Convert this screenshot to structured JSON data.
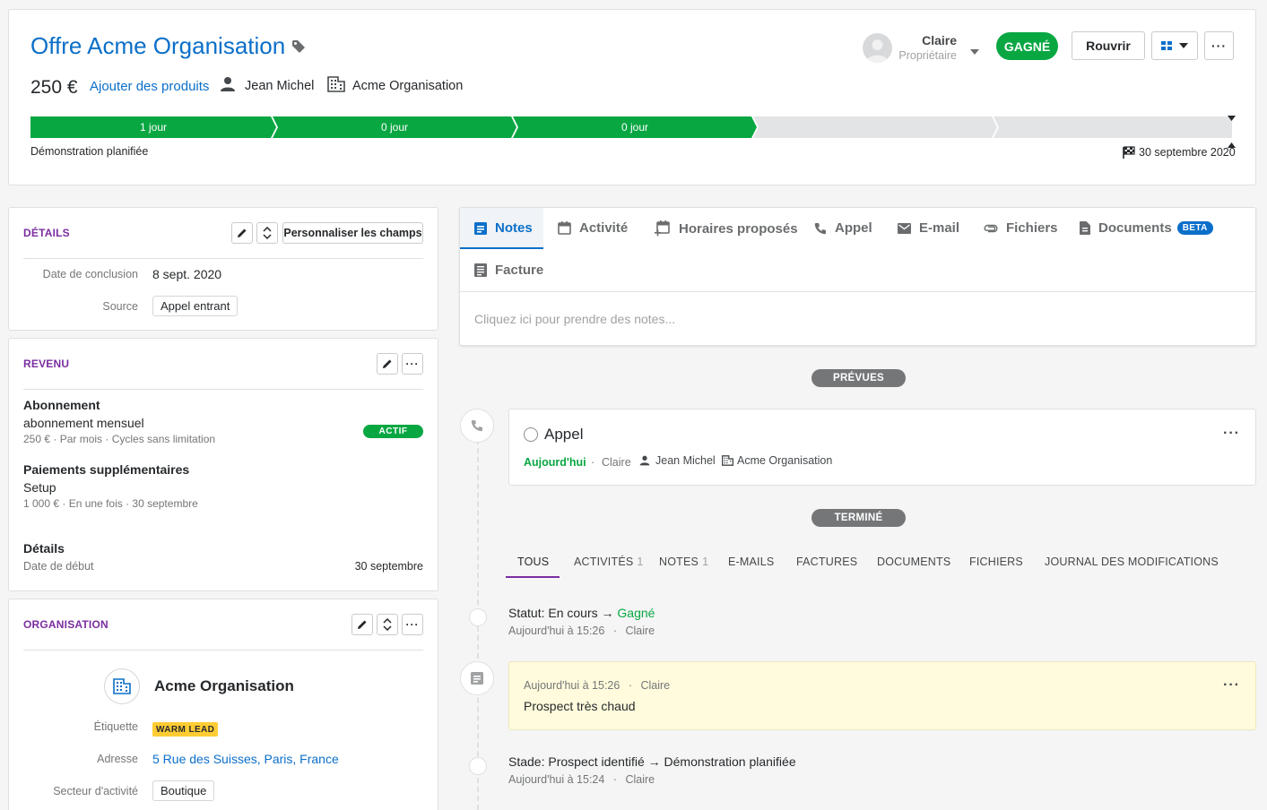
{
  "header": {
    "title": "Offre Acme Organisation",
    "amount": "250 €",
    "add_products": "Ajouter des produits",
    "person": "Jean Michel",
    "organization": "Acme Organisation",
    "owner_name": "Claire",
    "owner_role": "Propriétaire",
    "status_badge": "GAGNÉ",
    "reopen_button": "Rouvrir",
    "stages": [
      "1 jour",
      "0 jour",
      "0 jour",
      "",
      ""
    ],
    "stages_completed": 3,
    "current_stage": "Démonstration planifiée",
    "close_date": "30 septembre 2020"
  },
  "details": {
    "title": "DÉTAILS",
    "customize_button": "Personnaliser les champs",
    "close_date_label": "Date de conclusion",
    "close_date_value": "8 sept. 2020",
    "source_label": "Source",
    "source_value": "Appel entrant"
  },
  "revenue": {
    "title": "REVENU",
    "subscription_heading": "Abonnement",
    "subscription_name": "abonnement mensuel",
    "subscription_info": "250 € · Par mois · Cycles sans limitation",
    "subscription_status": "ACTIF",
    "payments_heading": "Paiements supplémentaires",
    "payment_name": "Setup",
    "payment_info": "1 000 € · En une fois · 30 septembre",
    "details_heading": "Détails",
    "start_date_label": "Date de début",
    "start_date_value": "30 septembre"
  },
  "organization": {
    "title": "ORGANISATION",
    "name": "Acme Organisation",
    "label_label": "Étiquette",
    "label_value": "WARM LEAD",
    "address_label": "Adresse",
    "address_value": "5 Rue des Suisses, Paris, France",
    "industry_label": "Secteur d'activité",
    "industry_value": "Boutique"
  },
  "composer": {
    "tabs": [
      {
        "label": "Notes",
        "icon": "note-icon"
      },
      {
        "label": "Activité",
        "icon": "calendar-icon"
      },
      {
        "label": "Horaires proposés",
        "icon": "calendar-plus-icon"
      },
      {
        "label": "Appel",
        "icon": "phone-icon"
      },
      {
        "label": "E-mail",
        "icon": "mail-icon"
      },
      {
        "label": "Fichiers",
        "icon": "paperclip-icon"
      },
      {
        "label": "Documents",
        "icon": "document-icon"
      },
      {
        "label": "Facture",
        "icon": "invoice-icon"
      }
    ],
    "beta_badge": "BETA",
    "placeholder": "Cliquez ici pour prendre des notes..."
  },
  "timeline": {
    "planned_label": "PRÉVUES",
    "done_label": "TERMINÉ",
    "call": {
      "title": "Appel",
      "when": "Aujourd'hui",
      "owner": "Claire",
      "person": "Jean Michel",
      "organization": "Acme Organisation"
    },
    "filters": [
      {
        "label": "TOUS",
        "count": ""
      },
      {
        "label": "ACTIVITÉS",
        "count": "1"
      },
      {
        "label": "NOTES",
        "count": "1"
      },
      {
        "label": "E-MAILS",
        "count": ""
      },
      {
        "label": "FACTURES",
        "count": ""
      },
      {
        "label": "DOCUMENTS",
        "count": ""
      },
      {
        "label": "FICHIERS",
        "count": ""
      },
      {
        "label": "JOURNAL DES MODIFICATIONS",
        "count": ""
      }
    ],
    "status_change": {
      "prefix": "Statut: En cours → ",
      "to": "Gagné",
      "when": "Aujourd'hui à 15:26",
      "who": "Claire"
    },
    "note": {
      "when": "Aujourd'hui à 15:26",
      "who": "Claire",
      "text": "Prospect très chaud"
    },
    "stage_change": {
      "text": "Stade: Prospect identifié → Démonstration planifiée",
      "when": "Aujourd'hui à 15:24",
      "who": "Claire"
    }
  },
  "colors": {
    "won_green": "#08a742",
    "link_blue": "#0b6fc9",
    "section_purple": "#7a2ea0",
    "warm_lead_yellow": "#ffcc33",
    "note_bg": "#fffbdc"
  }
}
